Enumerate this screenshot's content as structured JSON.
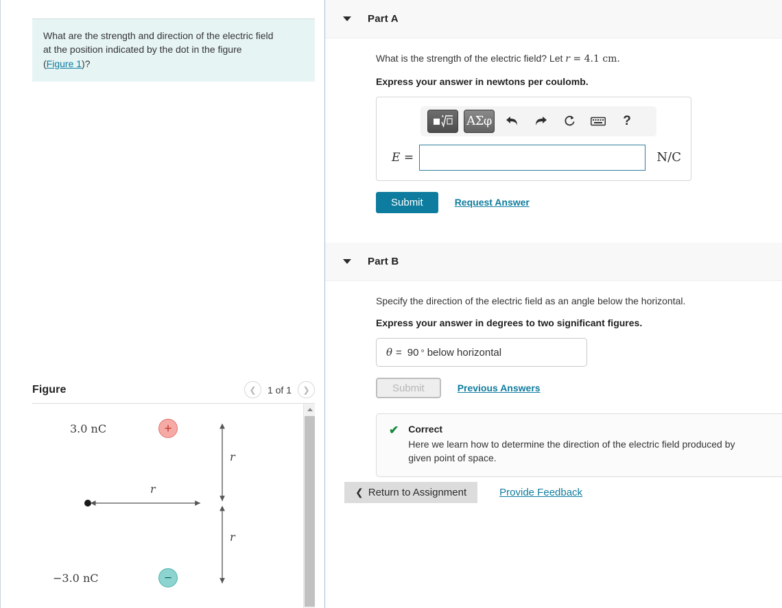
{
  "question": {
    "text_line1": "What are the strength and direction of the electric field",
    "text_line2": "at the position indicated by the dot in the figure",
    "open_paren": "(",
    "figure_link": "Figure 1",
    "close": ")?"
  },
  "figure": {
    "title": "Figure",
    "pager": {
      "prev_icon": "chevron-left-icon",
      "count": "1 of 1",
      "next_icon": "chevron-right-icon"
    },
    "scroll": {
      "up_arrow": "scroll-up-arrow"
    },
    "diagram": {
      "positive_charge_label": "3.0 nC",
      "positive_sign": "+",
      "negative_charge_label": "−3.0 nC",
      "negative_sign": "−",
      "distance_horizontal": "r",
      "distance_top": "r",
      "distance_bottom": "r",
      "positive_color": "#f6aaa6",
      "negative_color": "#8dd3cf"
    }
  },
  "partA": {
    "title": "Part A",
    "caret_icon": "caret-down-icon",
    "prompt_pre": "What is the strength of the electric field? Let ",
    "prompt_var": "r",
    "prompt_post": " = 4.1 cm.",
    "instruction": "Express your answer in newtons per coulomb.",
    "toolbar": {
      "template_button": "template-math-icon",
      "greek_button": "ΑΣφ",
      "undo_icon": "undo-icon",
      "redo_icon": "redo-icon",
      "reset_icon": "reset-icon",
      "keyboard_icon": "keyboard-icon",
      "help_icon": "?"
    },
    "variable": "E =",
    "input_value": "",
    "input_placeholder": "",
    "unit": "N/C",
    "submit_label": "Submit",
    "request_answer_label": "Request Answer"
  },
  "partB": {
    "title": "Part B",
    "caret_icon": "caret-down-icon",
    "prompt": "Specify the direction of the electric field as an angle below the horizontal.",
    "instruction": "Express your answer in degrees to two significant figures.",
    "answer": {
      "symbol": "θ",
      "equals": "=",
      "value": "90",
      "degree": "°",
      "suffix": "below horizontal"
    },
    "submit_label": "Submit",
    "previous_answers_label": "Previous Answers",
    "feedback": {
      "check_icon": "check-icon",
      "title": "Correct",
      "line1": "Here we learn how to determine the direction of the electric field produced by",
      "line2": "given point of space."
    }
  },
  "footer": {
    "return_icon": "chevron-left-icon",
    "return_label": "Return to Assignment",
    "provide_feedback_label": "Provide Feedback"
  },
  "colors": {
    "accent_teal": "#0e7c9e",
    "question_bg": "#e7f4f4",
    "part_header_bg": "#f8f8f8",
    "correct_green": "#1a8a3f"
  }
}
